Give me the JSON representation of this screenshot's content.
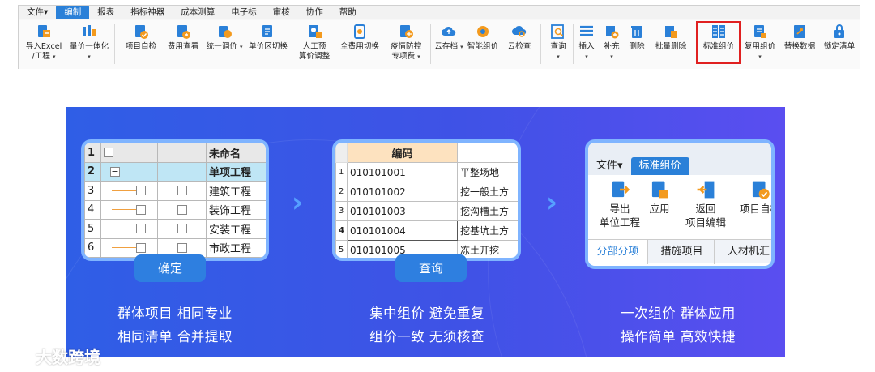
{
  "menu": [
    "文件▾",
    "编制",
    "报表",
    "指标神器",
    "成本测算",
    "电子标",
    "审核",
    "协作",
    "帮助"
  ],
  "ribbon": {
    "import_l1": "导入Excel",
    "import_l2": "/工程",
    "quote_one": "量价一体化",
    "self_check": "项目自检",
    "fee_view": "费用查看",
    "unify_price": "统一调价",
    "unit_switch": "单价区切换",
    "manual_l1": "人工预",
    "manual_l2": "算价调整",
    "full_fee": "全费用切换",
    "epidemic_l1": "疫情防控",
    "epidemic_l2": "专项费",
    "cloud_save": "云存档",
    "smart_price": "智能组价",
    "cloud_check": "云检查",
    "query": "查询",
    "insert": "插入",
    "supplement": "补充",
    "delete": "删除",
    "batch_delete": "批量删除",
    "standard_group": "标准组价",
    "reuse_group": "复用组价",
    "replace_data": "替换数据",
    "lock_list": "锁定清单",
    "dropdown": "▾"
  },
  "card1": {
    "header": [
      "1",
      "",
      "",
      "未命名"
    ],
    "rows": [
      {
        "num": "2",
        "name": "单项工程"
      },
      {
        "num": "3",
        "name": "建筑工程"
      },
      {
        "num": "4",
        "name": "装饰工程"
      },
      {
        "num": "5",
        "name": "安装工程"
      },
      {
        "num": "6",
        "name": "市政工程"
      }
    ],
    "collapse": "−",
    "button": "确定"
  },
  "card2": {
    "header": "编码",
    "rows": [
      {
        "num": "1",
        "code": "010101001",
        "name": "平整场地"
      },
      {
        "num": "2",
        "code": "010101002",
        "name": "挖一般土方"
      },
      {
        "num": "3",
        "code": "010101003",
        "name": "挖沟槽土方"
      },
      {
        "num": "4",
        "code": "010101004",
        "name": "挖基坑土方"
      },
      {
        "num": "5",
        "code": "010101005",
        "name": "冻土开挖"
      }
    ],
    "button": "查询"
  },
  "card3": {
    "menu_file": "文件▾",
    "menu_tab": "标准组价",
    "export_l1": "导出",
    "export_l2": "单位工程",
    "apply": "应用",
    "back_l1": "返回",
    "back_l2": "项目编辑",
    "self_check": "项目自检",
    "tabs": [
      "分部分项",
      "措施项目",
      "人材机汇"
    ]
  },
  "captions": {
    "c1_l1": "群体项目  相同专业",
    "c1_l2": "相同清单  合并提取",
    "c2_l1": "集中组价  避免重复",
    "c2_l2": "组价一致  无须核查",
    "c3_l1": "一次组价  群体应用",
    "c3_l2": "操作简单  高效快捷"
  },
  "watermark": "大数跨境",
  "colors": {
    "accent": "#2a80d8",
    "banner": "#3a57e8",
    "highlight": "#e02020"
  }
}
